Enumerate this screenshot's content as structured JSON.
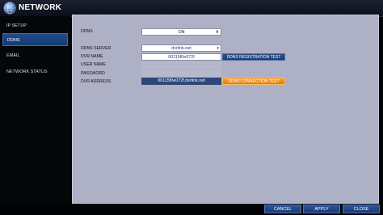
{
  "header": {
    "title": "NETWORK",
    "logo_icon": "globe-logo-icon"
  },
  "sidebar": {
    "items": [
      {
        "label": "IP SETUP"
      },
      {
        "label": "DDNS"
      },
      {
        "label": "EMAIL"
      },
      {
        "label": "NETWORK STATUS"
      }
    ],
    "active": "DDNS"
  },
  "form": {
    "ddns_label": "DDNS",
    "ddns_value": "ON",
    "ddns_server_label": "DDNS SERVER",
    "ddns_server_value": "dvrlink.net",
    "dvr_name_label": "DVR NAME",
    "dvr_name_value": "00115f0e072f",
    "registration_test_label": "DDNS REGISTRATION TEST",
    "user_name_label": "USER NAME",
    "password_label": "PASSWORD",
    "dvr_address_label": "DVR ADDRESS",
    "dvr_address_value": "00115f0e072f.dvrlink.net",
    "connection_test_label": "DDNS CONNECTION TEST"
  },
  "footer": {
    "cancel_label": "CANCEL",
    "apply_label": "APPLY",
    "close_label": "CLOSE"
  },
  "colors": {
    "panel_bg": "#aeb0c6",
    "accent_blue": "#2d4f8a",
    "accent_orange": "#f0922a"
  }
}
